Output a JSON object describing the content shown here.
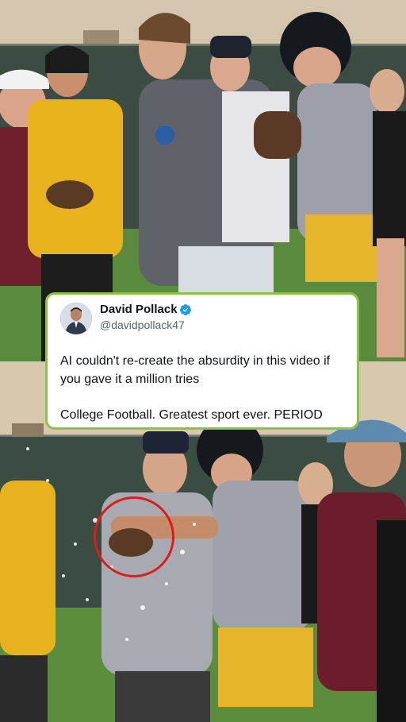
{
  "tweet": {
    "author_name": "David Pollack",
    "author_handle": "@davidpollack47",
    "text_line1": "AI couldn't re-create the absurdity in this video if you gave it a million tries",
    "text_line2": "College Football. Greatest sport ever. PERIOD",
    "verified_icon": "verified-badge-icon",
    "border_color": "#8bc34a"
  },
  "photos": {
    "top": "practice-field-photo",
    "bottom": "water-splash-photo"
  },
  "annotation": {
    "circle_color": "#e01b1b",
    "icon": "highlight-circle"
  }
}
